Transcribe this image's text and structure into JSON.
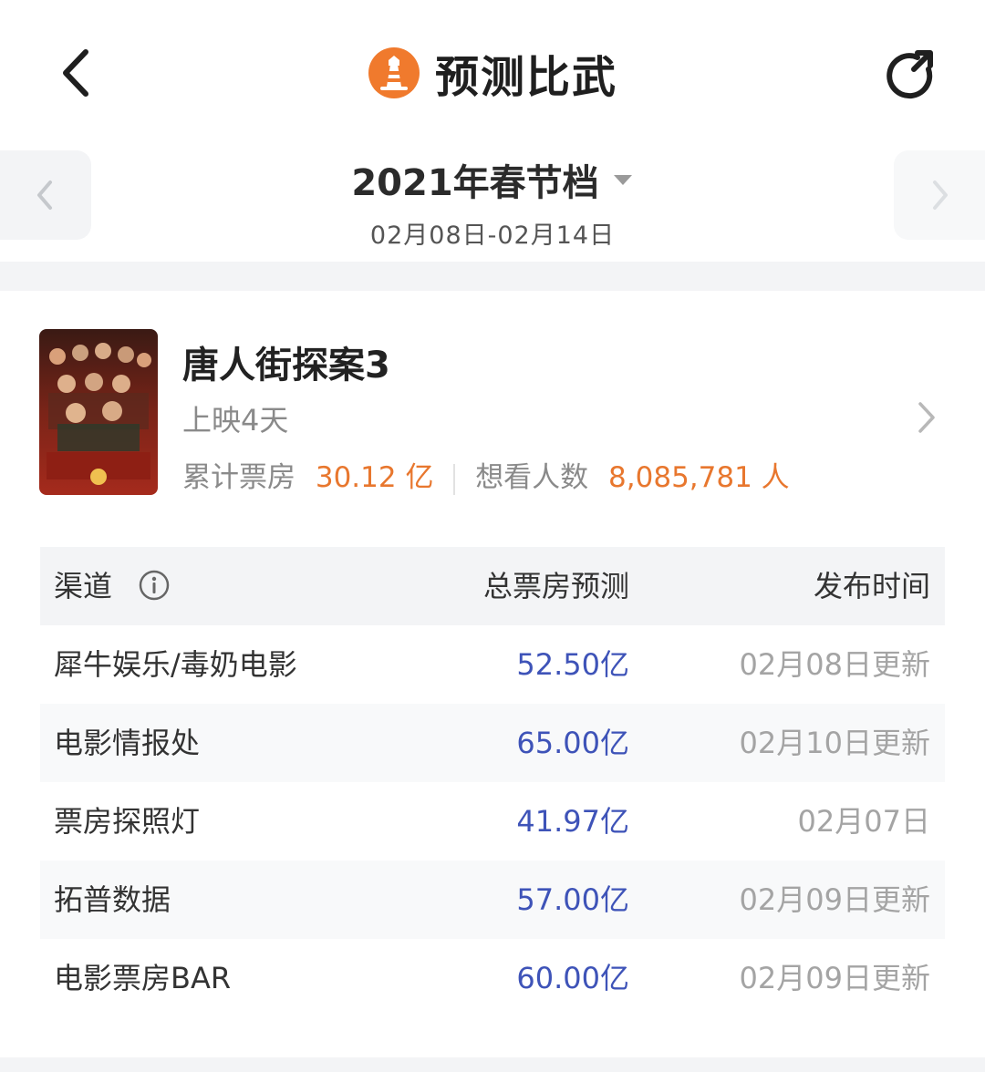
{
  "header": {
    "title": "预测比武",
    "back_icon": "chevron-left-icon",
    "logo_icon": "lighthouse-icon",
    "refresh_icon": "refresh-icon",
    "logo_color": "#f07a2d"
  },
  "period": {
    "title": "2021年春节档",
    "range": "02月08日-02月14日",
    "dropdown_icon": "caret-down-icon"
  },
  "movie": {
    "name": "唐人街探案3",
    "days": "上映4天",
    "box_office_label": "累计票房",
    "box_office_value": "30.12 亿",
    "want_label": "想看人数",
    "want_value": "8,085,781 人",
    "accent_color": "#e8772e"
  },
  "table": {
    "headers": {
      "channel": "渠道",
      "forecast": "总票房预测",
      "time": "发布时间"
    },
    "rows": [
      {
        "channel": "犀牛娱乐/毒奶电影",
        "forecast": "52.50亿",
        "time": "02月08日更新"
      },
      {
        "channel": "电影情报处",
        "forecast": "65.00亿",
        "time": "02月10日更新"
      },
      {
        "channel": "票房探照灯",
        "forecast": "41.97亿",
        "time": "02月07日"
      },
      {
        "channel": "拓普数据",
        "forecast": "57.00亿",
        "time": "02月09日更新"
      },
      {
        "channel": "电影票房BAR",
        "forecast": "60.00亿",
        "time": "02月09日更新"
      }
    ],
    "value_color": "#3e53b8"
  }
}
